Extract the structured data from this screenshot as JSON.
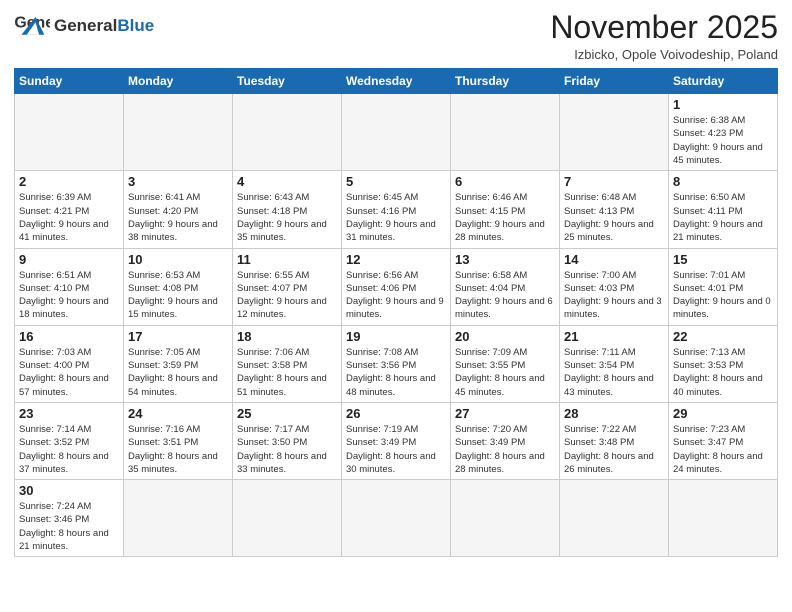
{
  "header": {
    "logo_general": "General",
    "logo_blue": "Blue",
    "month_title": "November 2025",
    "subtitle": "Izbicko, Opole Voivodeship, Poland"
  },
  "days_of_week": [
    "Sunday",
    "Monday",
    "Tuesday",
    "Wednesday",
    "Thursday",
    "Friday",
    "Saturday"
  ],
  "weeks": [
    [
      {
        "day": "",
        "info": ""
      },
      {
        "day": "",
        "info": ""
      },
      {
        "day": "",
        "info": ""
      },
      {
        "day": "",
        "info": ""
      },
      {
        "day": "",
        "info": ""
      },
      {
        "day": "",
        "info": ""
      },
      {
        "day": "1",
        "info": "Sunrise: 6:38 AM\nSunset: 4:23 PM\nDaylight: 9 hours and 45 minutes."
      }
    ],
    [
      {
        "day": "2",
        "info": "Sunrise: 6:39 AM\nSunset: 4:21 PM\nDaylight: 9 hours and 41 minutes."
      },
      {
        "day": "3",
        "info": "Sunrise: 6:41 AM\nSunset: 4:20 PM\nDaylight: 9 hours and 38 minutes."
      },
      {
        "day": "4",
        "info": "Sunrise: 6:43 AM\nSunset: 4:18 PM\nDaylight: 9 hours and 35 minutes."
      },
      {
        "day": "5",
        "info": "Sunrise: 6:45 AM\nSunset: 4:16 PM\nDaylight: 9 hours and 31 minutes."
      },
      {
        "day": "6",
        "info": "Sunrise: 6:46 AM\nSunset: 4:15 PM\nDaylight: 9 hours and 28 minutes."
      },
      {
        "day": "7",
        "info": "Sunrise: 6:48 AM\nSunset: 4:13 PM\nDaylight: 9 hours and 25 minutes."
      },
      {
        "day": "8",
        "info": "Sunrise: 6:50 AM\nSunset: 4:11 PM\nDaylight: 9 hours and 21 minutes."
      }
    ],
    [
      {
        "day": "9",
        "info": "Sunrise: 6:51 AM\nSunset: 4:10 PM\nDaylight: 9 hours and 18 minutes."
      },
      {
        "day": "10",
        "info": "Sunrise: 6:53 AM\nSunset: 4:08 PM\nDaylight: 9 hours and 15 minutes."
      },
      {
        "day": "11",
        "info": "Sunrise: 6:55 AM\nSunset: 4:07 PM\nDaylight: 9 hours and 12 minutes."
      },
      {
        "day": "12",
        "info": "Sunrise: 6:56 AM\nSunset: 4:06 PM\nDaylight: 9 hours and 9 minutes."
      },
      {
        "day": "13",
        "info": "Sunrise: 6:58 AM\nSunset: 4:04 PM\nDaylight: 9 hours and 6 minutes."
      },
      {
        "day": "14",
        "info": "Sunrise: 7:00 AM\nSunset: 4:03 PM\nDaylight: 9 hours and 3 minutes."
      },
      {
        "day": "15",
        "info": "Sunrise: 7:01 AM\nSunset: 4:01 PM\nDaylight: 9 hours and 0 minutes."
      }
    ],
    [
      {
        "day": "16",
        "info": "Sunrise: 7:03 AM\nSunset: 4:00 PM\nDaylight: 8 hours and 57 minutes."
      },
      {
        "day": "17",
        "info": "Sunrise: 7:05 AM\nSunset: 3:59 PM\nDaylight: 8 hours and 54 minutes."
      },
      {
        "day": "18",
        "info": "Sunrise: 7:06 AM\nSunset: 3:58 PM\nDaylight: 8 hours and 51 minutes."
      },
      {
        "day": "19",
        "info": "Sunrise: 7:08 AM\nSunset: 3:56 PM\nDaylight: 8 hours and 48 minutes."
      },
      {
        "day": "20",
        "info": "Sunrise: 7:09 AM\nSunset: 3:55 PM\nDaylight: 8 hours and 45 minutes."
      },
      {
        "day": "21",
        "info": "Sunrise: 7:11 AM\nSunset: 3:54 PM\nDaylight: 8 hours and 43 minutes."
      },
      {
        "day": "22",
        "info": "Sunrise: 7:13 AM\nSunset: 3:53 PM\nDaylight: 8 hours and 40 minutes."
      }
    ],
    [
      {
        "day": "23",
        "info": "Sunrise: 7:14 AM\nSunset: 3:52 PM\nDaylight: 8 hours and 37 minutes."
      },
      {
        "day": "24",
        "info": "Sunrise: 7:16 AM\nSunset: 3:51 PM\nDaylight: 8 hours and 35 minutes."
      },
      {
        "day": "25",
        "info": "Sunrise: 7:17 AM\nSunset: 3:50 PM\nDaylight: 8 hours and 33 minutes."
      },
      {
        "day": "26",
        "info": "Sunrise: 7:19 AM\nSunset: 3:49 PM\nDaylight: 8 hours and 30 minutes."
      },
      {
        "day": "27",
        "info": "Sunrise: 7:20 AM\nSunset: 3:49 PM\nDaylight: 8 hours and 28 minutes."
      },
      {
        "day": "28",
        "info": "Sunrise: 7:22 AM\nSunset: 3:48 PM\nDaylight: 8 hours and 26 minutes."
      },
      {
        "day": "29",
        "info": "Sunrise: 7:23 AM\nSunset: 3:47 PM\nDaylight: 8 hours and 24 minutes."
      }
    ],
    [
      {
        "day": "30",
        "info": "Sunrise: 7:24 AM\nSunset: 3:46 PM\nDaylight: 8 hours and 21 minutes."
      },
      {
        "day": "",
        "info": ""
      },
      {
        "day": "",
        "info": ""
      },
      {
        "day": "",
        "info": ""
      },
      {
        "day": "",
        "info": ""
      },
      {
        "day": "",
        "info": ""
      },
      {
        "day": "",
        "info": ""
      }
    ]
  ]
}
